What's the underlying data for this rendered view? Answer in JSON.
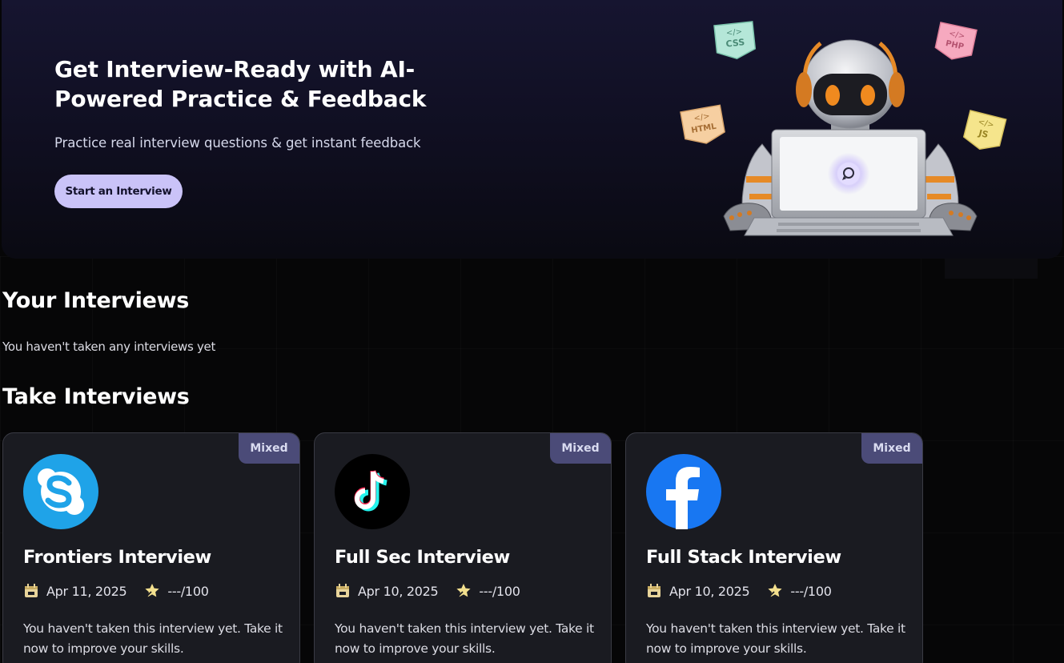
{
  "hero": {
    "title": "Get Interview-Ready with AI-Powered Practice & Feedback",
    "title_line1": "Get Interview-Ready with AI-",
    "title_line2": "Powered Practice & Feedback",
    "subtitle": "Practice real interview questions & get instant feedback",
    "cta_label": "Start an Interview",
    "tags": [
      "CSS",
      "PHP",
      "HTML",
      "JS"
    ],
    "tag_glyph": "</>"
  },
  "your_interviews": {
    "title": "Your Interviews",
    "empty_text": "You haven't taken any interviews yet"
  },
  "take_interviews": {
    "title": "Take Interviews",
    "cards": [
      {
        "badge": "Mixed",
        "logo": "skype-logo",
        "title": "Frontiers Interview",
        "date": "Apr 11, 2025",
        "score": "---/100",
        "description": "You haven't taken this interview yet. Take it now to improve your skills."
      },
      {
        "badge": "Mixed",
        "logo": "tiktok-logo",
        "title": "Full Sec Interview",
        "date": "Apr 10, 2025",
        "score": "---/100",
        "description": "You haven't taken this interview yet. Take it now to improve your skills."
      },
      {
        "badge": "Mixed",
        "logo": "facebook-logo",
        "title": "Full Stack Interview",
        "date": "Apr 10, 2025",
        "score": "---/100",
        "description": "You haven't taken this interview yet. Take it now to improve your skills."
      }
    ]
  },
  "icons": {
    "date": "calendar-icon",
    "score": "star-icon"
  },
  "colors": {
    "accent_button": "#cac3f8",
    "badge_bg": "#4b4b78",
    "card_bg": "#1a1b21",
    "hero_bg": "#161530",
    "skype_blue": "#1fa3e8",
    "facebook_blue": "#1877f2",
    "calendar_gold": "#e8d49a",
    "star_gold": "#f3e08e"
  }
}
